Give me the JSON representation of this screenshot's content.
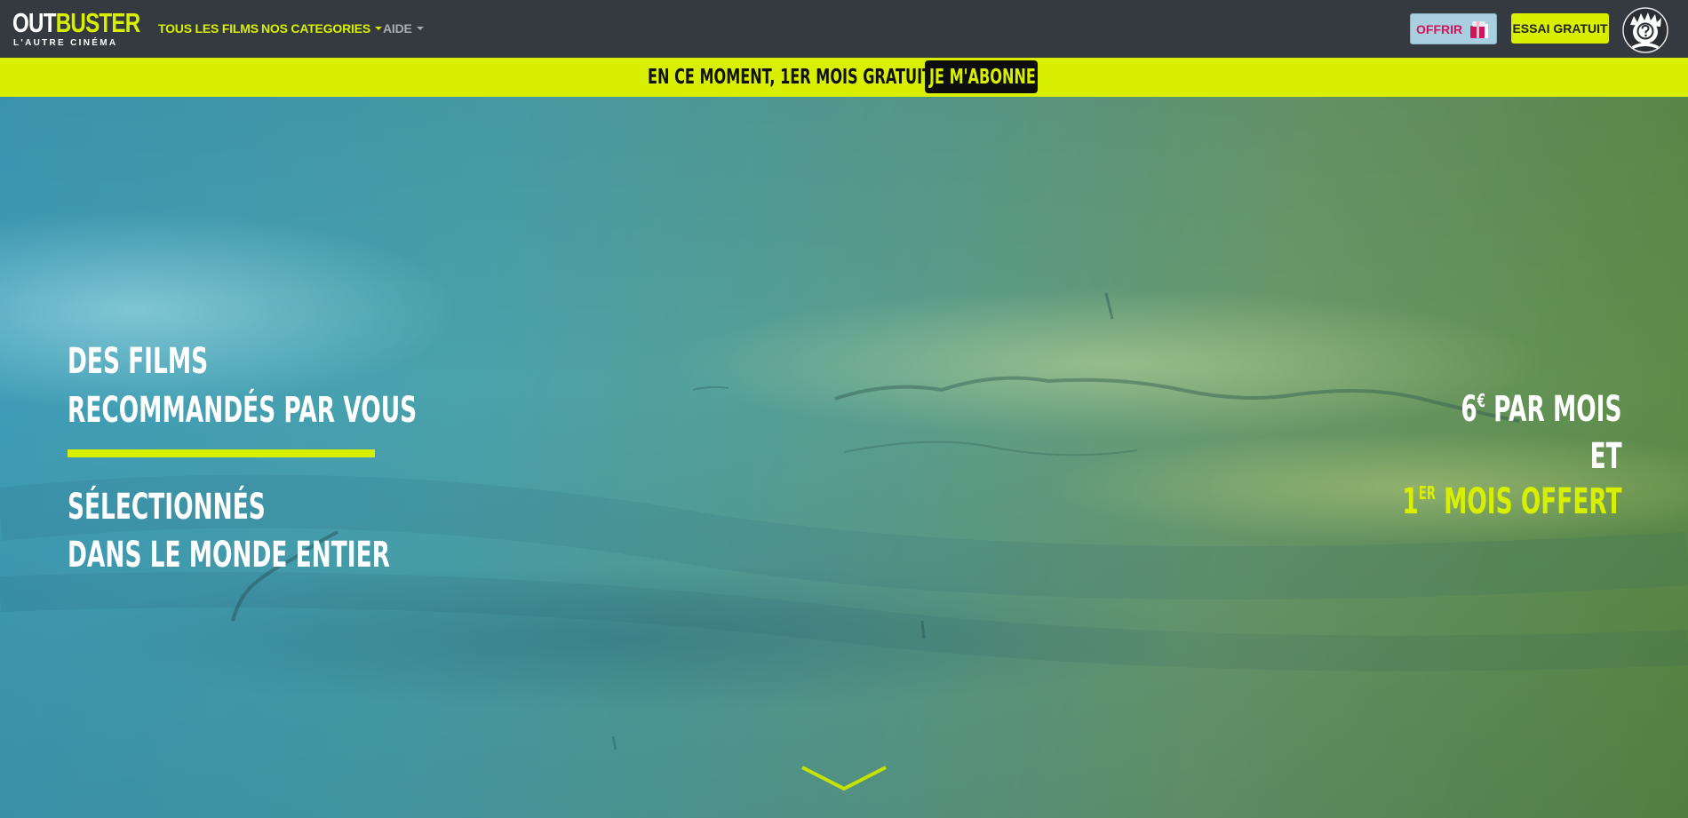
{
  "brand": {
    "logo_part1": "OUT",
    "logo_part2": "BUSTER",
    "tagline": "L'AUTRE CINÉMA"
  },
  "nav": {
    "items": [
      {
        "label": "TOUS LES FILMS"
      },
      {
        "label": "NOS CATEGORIES"
      },
      {
        "label": "AIDE"
      }
    ]
  },
  "header_actions": {
    "offer_label": "OFFRIR",
    "trial_label": "ESSAI GRATUIT"
  },
  "promo": {
    "text": "EN CE MOMENT, 1ER MOIS GRATUIT",
    "button_label": "JE M'ABONNE"
  },
  "hero": {
    "headline": [
      "DES FILMS",
      "RECOMMANDÉS PAR VOUS",
      "SÉLECTIONNÉS",
      "DANS LE MONDE ENTIER"
    ],
    "price": {
      "amount": "6",
      "currency": "€",
      "suffix": " PAR MOIS",
      "connector": "ET",
      "first": "1",
      "first_sup": "ER",
      "offer": " MOIS OFFERT"
    }
  },
  "colors": {
    "accent": "#d8f000",
    "navbar": "#343a40",
    "offer_button": "#a9cfe0",
    "offer_text": "#d4145a"
  },
  "icons": {
    "gift": "gift-icon",
    "avatar": "user-avatar-icon",
    "scroll": "chevron-down-icon"
  }
}
